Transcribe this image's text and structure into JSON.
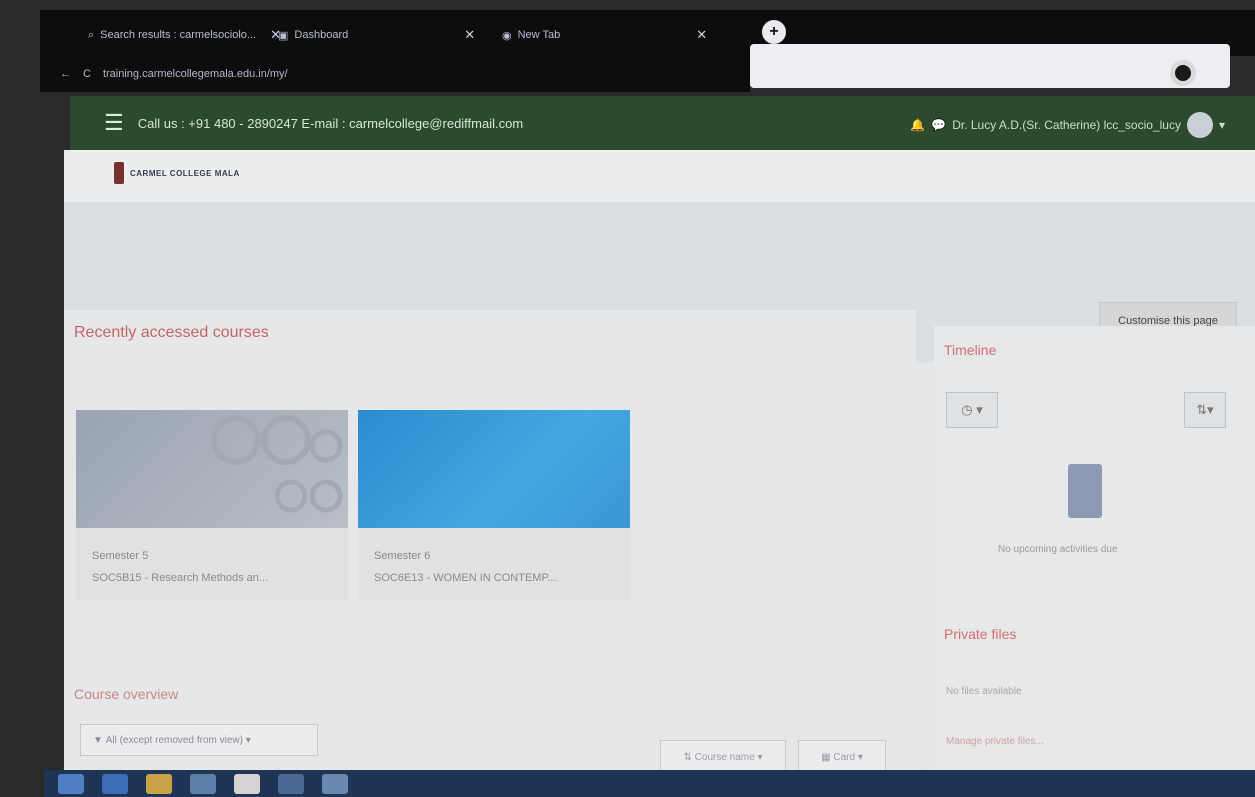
{
  "browser": {
    "tabs": [
      {
        "label": "Search results : carmelsociolo...",
        "icon": "search-icon"
      },
      {
        "label": "Dashboard",
        "icon": "dashboard-icon"
      },
      {
        "label": "New Tab",
        "icon": "chrome-icon"
      }
    ],
    "address": "training.carmelcollegemala.edu.in/my/",
    "new_tab_symbol": "+"
  },
  "header": {
    "contact": "Call us : +91 480 - 2890247  E-mail : carmelcollege@rediffmail.com",
    "user_name": "Dr. Lucy A.D.(Sr. Catherine) lcc_socio_lucy",
    "brand": "CARMEL COLLEGE MALA"
  },
  "main": {
    "customise_label": "Customise this page",
    "recent_title": "Recently accessed courses",
    "courses": [
      {
        "semester": "Semester 5",
        "name": "SOC5B15 - Research Methods an..."
      },
      {
        "semester": "Semester 6",
        "name": "SOC6E13 - WOMEN IN CONTEMP..."
      }
    ],
    "overview_title": "Course overview",
    "filter_label": "All (except removed from view)",
    "sort_label": "Course name",
    "view_label": "Card"
  },
  "side": {
    "timeline_title": "Timeline",
    "timeline_empty": "No upcoming activities due",
    "private_files_title": "Private files",
    "no_files": "No files available",
    "manage_files": "Manage private files..."
  },
  "colors": {
    "nav": "#2b4a2e",
    "accent": "#c56464"
  }
}
